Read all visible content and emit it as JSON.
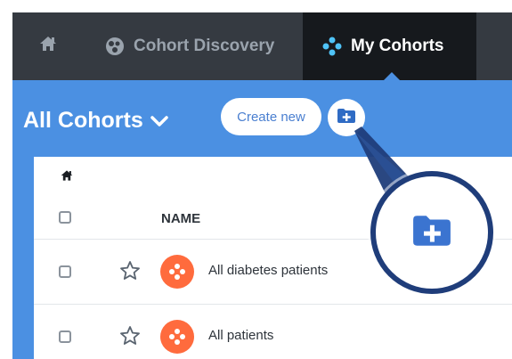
{
  "nav": {
    "home_icon": "home-icon",
    "cohort_discovery_label": "Cohort Discovery",
    "my_cohorts_label": "My Cohorts"
  },
  "page": {
    "title": "All Cohorts",
    "create_new_label": "Create new"
  },
  "table": {
    "name_header": "NAME",
    "rows": [
      {
        "label": "All diabetes patients"
      },
      {
        "label": "All patients"
      }
    ]
  },
  "colors": {
    "topbar": "#353a41",
    "active_tab": "#16191d",
    "primary_blue": "#4b90e2",
    "cohort_orange": "#ff6b3d",
    "zoom_ring": "#1f3d7a"
  }
}
